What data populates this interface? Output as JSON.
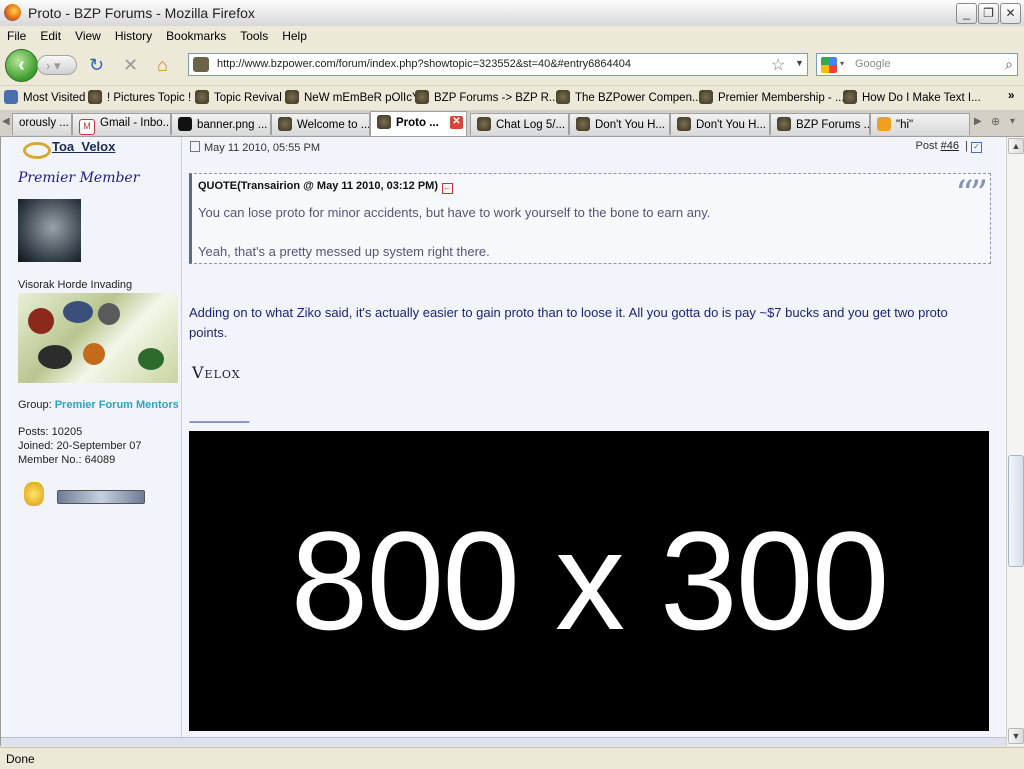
{
  "window": {
    "title": "Proto - BZP Forums - Mozilla Firefox",
    "controls": [
      "_",
      "❐",
      "✕"
    ]
  },
  "menu": [
    "File",
    "Edit",
    "View",
    "History",
    "Bookmarks",
    "Tools",
    "Help"
  ],
  "nav": {
    "url": "http://www.bzpower.com/forum/index.php?showtopic=323552&st=40&#entry6864404",
    "search_placeholder": "Google"
  },
  "bookmarks": [
    "Most Visited",
    "! Pictures Topic !",
    "Topic Revival",
    "NeW mEmBeR pOlIcY",
    "BZP Forums -> BZP R...",
    "The BZPower Compen...",
    "Premier Membership - ...",
    "How Do I Make Text I..."
  ],
  "bookmarks_more": "»",
  "tabs": [
    {
      "label": "orously ...",
      "active": false
    },
    {
      "label": "Gmail - Inbo...",
      "active": false
    },
    {
      "label": "banner.png ...",
      "active": false
    },
    {
      "label": "Welcome to ...",
      "active": false
    },
    {
      "label": "Proto ...",
      "active": true
    },
    {
      "label": "Chat Log 5/...",
      "active": false
    },
    {
      "label": "Don't You H...",
      "active": false
    },
    {
      "label": "Don't You H...",
      "active": false
    },
    {
      "label": "BZP Forums ...",
      "active": false
    },
    {
      "label": "\"hi\"",
      "active": false
    }
  ],
  "author": {
    "name": "Toa_Velox",
    "rank": "Premier Member",
    "sig_title": "Visorak Horde Invading",
    "group_label": "Group:",
    "group": "Premier Forum Mentors",
    "posts": "Posts: 10205",
    "joined": "Joined: 20-September 07",
    "member_no": "Member No.: 64089"
  },
  "post": {
    "date": "May 11 2010, 05:55 PM",
    "post_label": "Post",
    "post_number": "#46",
    "quote_header": "QUOTE(Transairion @ May 11 2010, 03:12 PM)",
    "quote_line1": "You can lose proto for minor accidents, but have to work yourself to the bone to earn any.",
    "quote_line2": "Yeah, that's a pretty messed up system right there.",
    "body": "Adding on to what Ziko said, it's actually easier to gain proto than to loose it. All you gotta do is pay ~$7 bucks and you get two proto points.",
    "signature": "Velox",
    "divider": "--------------------",
    "banner_text": "800 x 300"
  },
  "status": "Done"
}
